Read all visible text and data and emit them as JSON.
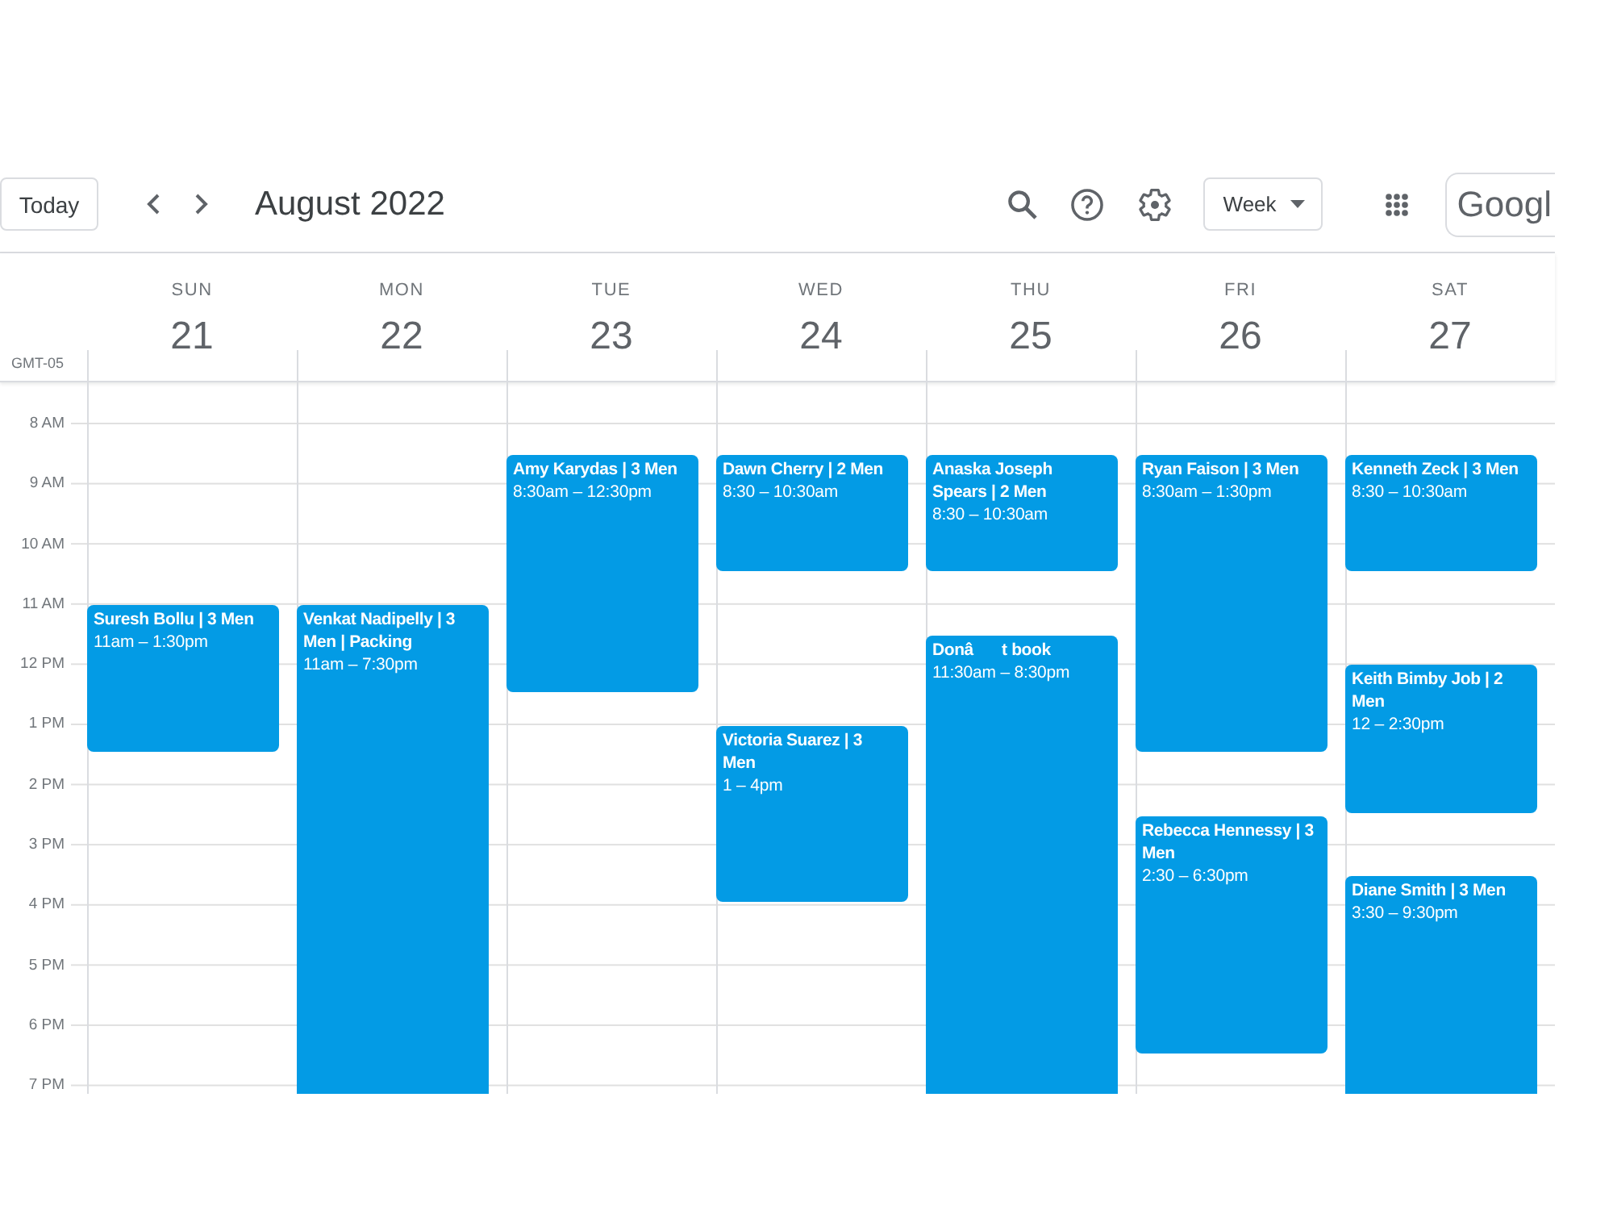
{
  "toolbar": {
    "today_button": "Today",
    "title": "August 2022",
    "view_select": "Week",
    "logo_text": "Googl"
  },
  "timezone": "GMT-05",
  "hours": [
    "8 AM",
    "9 AM",
    "10 AM",
    "11 AM",
    "12 PM",
    "1 PM",
    "2 PM",
    "3 PM",
    "4 PM",
    "5 PM",
    "6 PM",
    "7 PM"
  ],
  "days": [
    {
      "name": "SUN",
      "date": "21",
      "events": [
        {
          "title": "Suresh Bollu | 3 Men",
          "time": "11am – 1:30pm"
        }
      ]
    },
    {
      "name": "MON",
      "date": "22",
      "events": [
        {
          "title": "Venkat Nadipelly | 3 Men | Packing",
          "time": "11am – 7:30pm"
        }
      ]
    },
    {
      "name": "TUE",
      "date": "23",
      "events": [
        {
          "title": "Amy Karydas | 3 Men",
          "time": "8:30am – 12:30pm"
        }
      ]
    },
    {
      "name": "WED",
      "date": "24",
      "events": [
        {
          "title": "Dawn Cherry | 2 Men",
          "time": "8:30 – 10:30am"
        },
        {
          "title": "Victoria Suarez | 3 Men",
          "time": "1 – 4pm"
        }
      ]
    },
    {
      "name": "THU",
      "date": "25",
      "events": [
        {
          "title": "Anaska Joseph Spears | 2 Men",
          "time": "8:30 – 10:30am"
        },
        {
          "title": "Donât book",
          "time": "11:30am – 8:30pm"
        }
      ]
    },
    {
      "name": "FRI",
      "date": "26",
      "events": [
        {
          "title": "Ryan Faison | 3 Men",
          "time": "8:30am – 1:30pm"
        },
        {
          "title": "Rebecca Hennessy | 3 Men",
          "time": "2:30 – 6:30pm"
        }
      ]
    },
    {
      "name": "SAT",
      "date": "27",
      "events": [
        {
          "title": "Kenneth Zeck | 3 Men",
          "time": "8:30 – 10:30am"
        },
        {
          "title": "Keith Bimby Job | 2 Men",
          "time": "12 – 2:30pm"
        },
        {
          "title": "Diane Smith | 3 Men",
          "time": "3:30 – 9:30pm"
        }
      ]
    }
  ]
}
